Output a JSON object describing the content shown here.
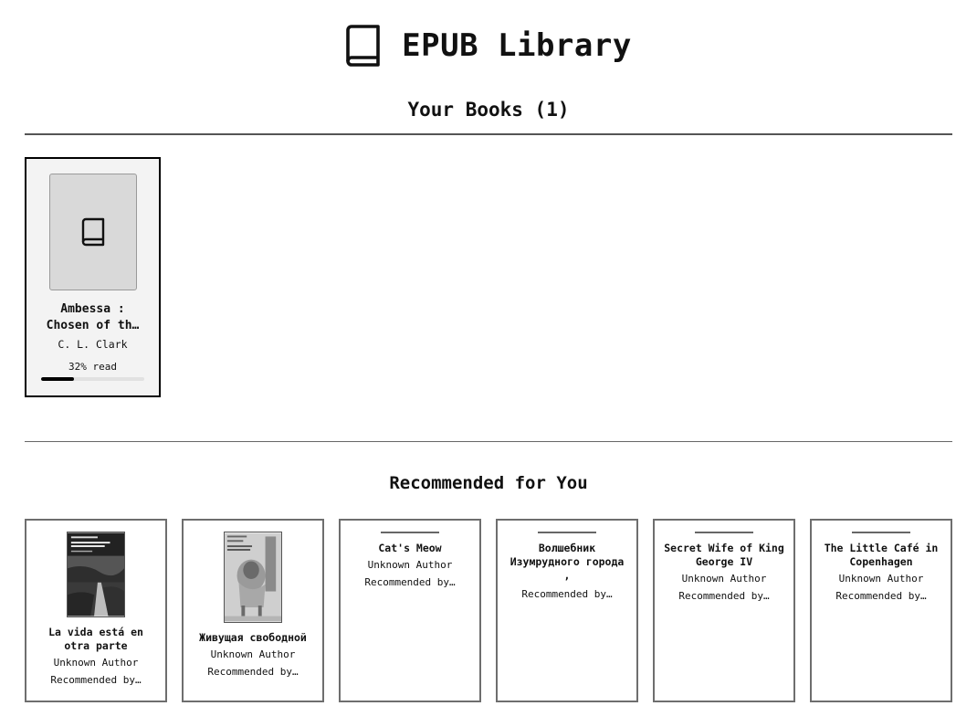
{
  "app": {
    "title": "EPUB Library",
    "logo_icon": "book-icon"
  },
  "library": {
    "heading": "Your Books (1)",
    "books": [
      {
        "title": "Ambessa :\nChosen of th…",
        "author": "C. L. Clark",
        "progress_text": "32% read",
        "progress": 0.32,
        "cover_icon": "book-icon"
      }
    ]
  },
  "recommended": {
    "heading": "Recommended for You",
    "items": [
      {
        "title": "La vida está en\notra parte",
        "author": "Unknown Author",
        "reason": "Recommended by…",
        "has_cover": true
      },
      {
        "title": "Живущая свободной",
        "author": "Unknown Author",
        "reason": "Recommended by…",
        "has_cover": true
      },
      {
        "title": "Cat's Meow",
        "author": "Unknown Author",
        "reason": "Recommended by…",
        "has_cover": false
      },
      {
        "title": "Волшебник\nИзумрудного города\n,",
        "author": "",
        "reason": "Recommended by…",
        "has_cover": false
      },
      {
        "title": "Secret Wife of King\nGeorge IV",
        "author": "Unknown Author",
        "reason": "Recommended by…",
        "has_cover": false
      },
      {
        "title": "The Little Café in\nCopenhagen",
        "author": "Unknown Author",
        "reason": "Recommended by…",
        "has_cover": false
      }
    ]
  }
}
